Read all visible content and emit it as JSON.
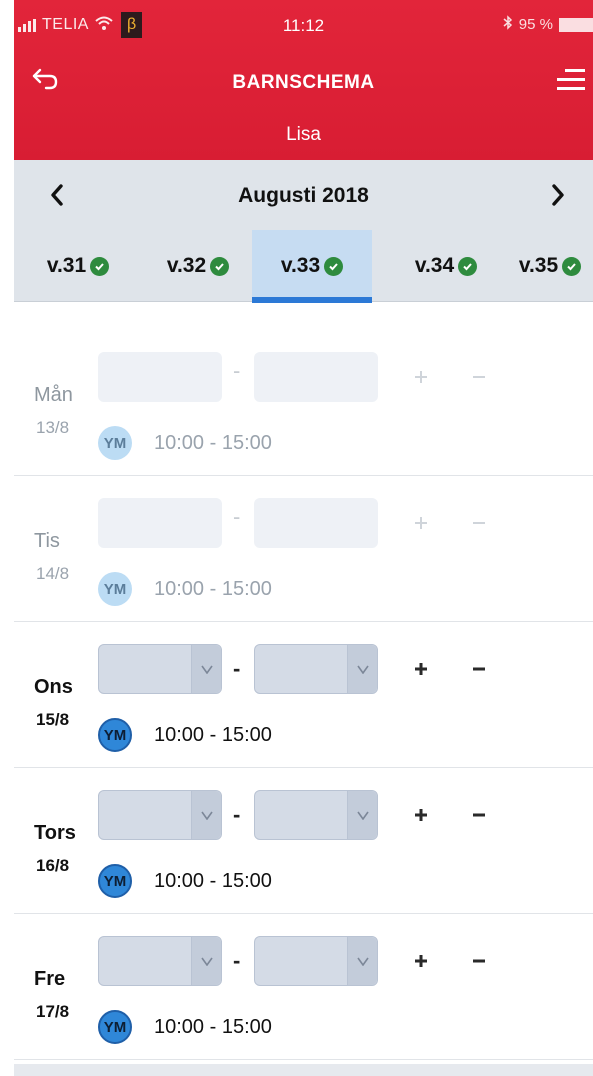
{
  "status_bar": {
    "carrier": "TELIA",
    "beta": "β",
    "time": "11:12",
    "battery": "95 %"
  },
  "header": {
    "back_icon": "back-arrow-icon",
    "title": "BARNSCHEMA",
    "subtitle": "Lisa",
    "menu_icon": "hamburger-menu-icon",
    "color": "#dc2137"
  },
  "month_nav": {
    "label": "Augusti 2018",
    "prev_icon": "chevron-left-icon",
    "next_icon": "chevron-right-icon"
  },
  "weeks": [
    {
      "label": "v.31",
      "done": true,
      "active": false
    },
    {
      "label": "v.32",
      "done": true,
      "active": false
    },
    {
      "label": "v.33",
      "done": true,
      "active": true
    },
    {
      "label": "v.34",
      "done": true,
      "active": false
    },
    {
      "label": "v.35",
      "done": true,
      "active": false
    }
  ],
  "days": [
    {
      "name": "Mån",
      "date": "13/8",
      "state": "past",
      "dash": "-",
      "avatar": "YM",
      "time": "10:00 - 15:00"
    },
    {
      "name": "Tis",
      "date": "14/8",
      "state": "past",
      "dash": "-",
      "avatar": "YM",
      "time": "10:00 - 15:00"
    },
    {
      "name": "Ons",
      "date": "15/8",
      "state": "current",
      "dash": "-",
      "avatar": "YM",
      "time": "10:00 - 15:00"
    },
    {
      "name": "Tors",
      "date": "16/8",
      "state": "current",
      "dash": "-",
      "avatar": "YM",
      "time": "10:00 - 15:00"
    },
    {
      "name": "Fre",
      "date": "17/8",
      "state": "current",
      "dash": "-",
      "avatar": "YM",
      "time": "10:00 - 15:00"
    }
  ],
  "colors": {
    "accent": "#2c79d6",
    "check": "#2e8b3e",
    "avatar_active": "#2f87d8",
    "avatar_past": "#bcdcf4"
  }
}
